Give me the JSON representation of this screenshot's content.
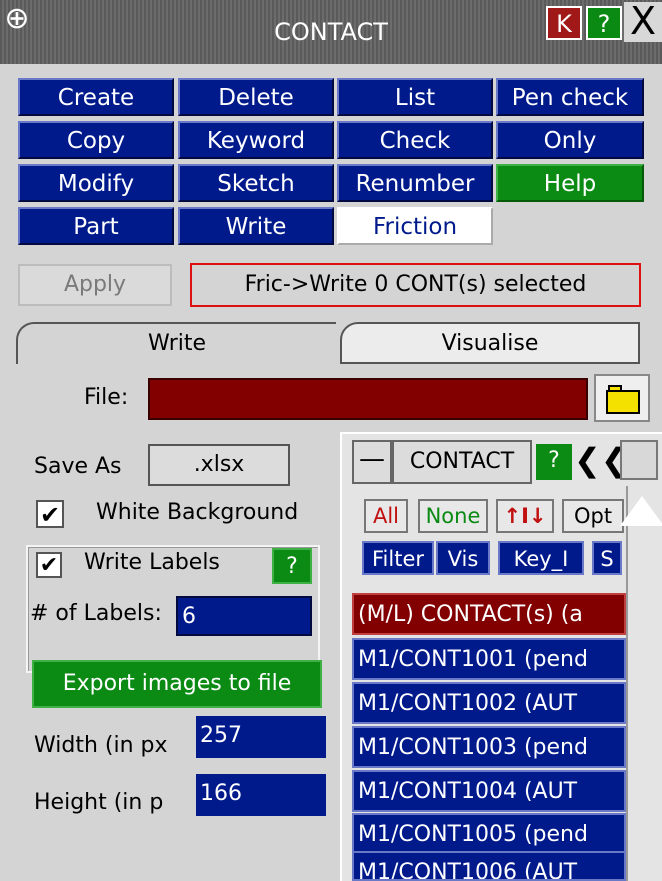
{
  "window": {
    "title": "CONTACT",
    "k_label": "K",
    "help_label": "?",
    "close_label": "X",
    "menu_icon": "plus-box-icon"
  },
  "grid": {
    "row1": [
      "Create",
      "Delete",
      "List",
      "Pen check"
    ],
    "row2": [
      "Copy",
      "Keyword",
      "Check",
      "Only"
    ],
    "row3": [
      "Modify",
      "Sketch",
      "Renumber",
      "Help"
    ],
    "row4": [
      "Part",
      "Write",
      "Friction"
    ]
  },
  "apply_label": "Apply",
  "status_text": "Fric->Write 0 CONT(s) selected",
  "tabs": {
    "write": "Write",
    "visualise": "Visualise"
  },
  "file": {
    "label": "File:",
    "value": ""
  },
  "save_as": {
    "label": "Save As",
    "value": ".xlsx"
  },
  "white_background": {
    "label": "White Background",
    "checked": true
  },
  "write_labels": {
    "label": "Write Labels",
    "checked": true,
    "help": "?"
  },
  "num_labels": {
    "label": "# of Labels:",
    "value": "6"
  },
  "export_label": "Export images to file",
  "width": {
    "label": "Width (in px",
    "value": "257"
  },
  "height": {
    "label": "Height (in p",
    "value": "166"
  },
  "list_panel": {
    "title": "CONTACT",
    "minimize": "—",
    "help": "?",
    "back": "❮❮",
    "buttons": {
      "all": "All",
      "none": "None",
      "sort": "↑I↓",
      "opt": "Opt"
    },
    "blue_buttons": {
      "filter": "Filter",
      "vis": "Vis",
      "key": "Key_I",
      "s": "S"
    },
    "header_row": "(M/L) CONTACT(s) (a",
    "rows": [
      "M1/CONT1001 (pend",
      "M1/CONT1002 (AUT",
      "M1/CONT1003 (pend",
      "M1/CONT1004 (AUT",
      "M1/CONT1005 (pend",
      "M1/CONT1006 (AUT"
    ]
  },
  "colors": {
    "button_blue": "#001a8c",
    "button_green": "#0b8a14",
    "file_field": "#820000",
    "header_red": "#820000"
  }
}
